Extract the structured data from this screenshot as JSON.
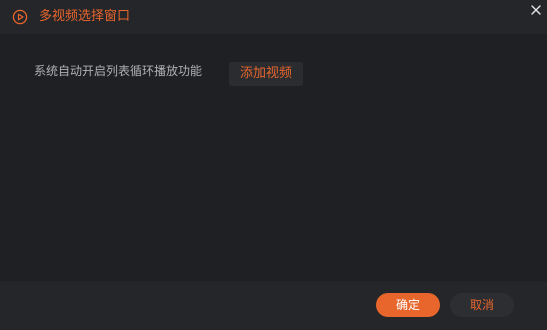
{
  "colors": {
    "accent": "#e8662c",
    "background": "#1f2023",
    "titlebar": "#25262a",
    "text_muted": "#aeb0b4"
  },
  "titlebar": {
    "icon": "play-circle-icon",
    "title": "多视频选择窗口",
    "close_icon": "close-icon"
  },
  "body": {
    "hint": "系统自动开启列表循环播放功能",
    "add_video_label": "添加视频"
  },
  "footer": {
    "ok_label": "确定",
    "cancel_label": "取消"
  }
}
